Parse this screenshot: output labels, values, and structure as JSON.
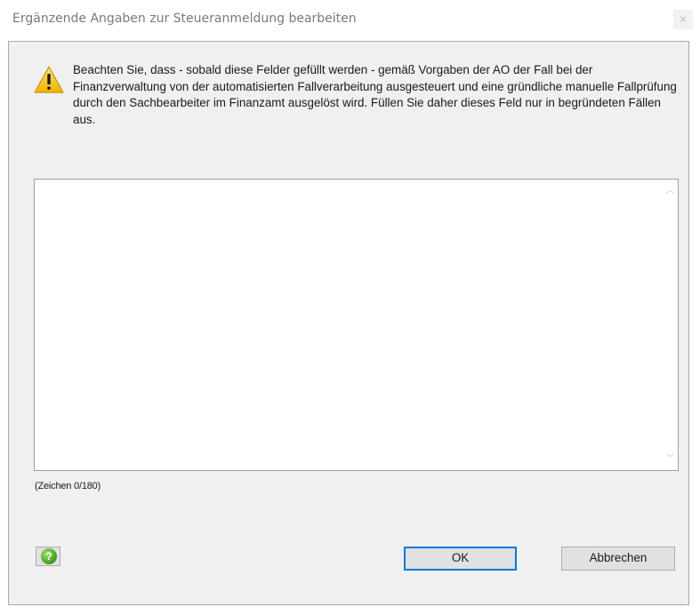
{
  "window": {
    "title": "Ergänzende Angaben zur Steueranmeldung bearbeiten",
    "close_glyph": "✕"
  },
  "warning": {
    "icon": "warning-triangle-icon",
    "text": "Beachten Sie, dass - sobald diese Felder gefüllt werden - gemäß Vorgaben der AO der Fall bei der Finanzverwaltung von der automatisierten Fallverarbeitung ausgesteuert und eine gründliche manuelle Fallprüfung durch den Sachbearbeiter im Finanzamt ausgelöst wird. Füllen Sie daher dieses Feld nur in begründeten Fällen aus."
  },
  "textbox": {
    "value": "",
    "scroll_up_glyph": "︿",
    "scroll_down_glyph": "﹀"
  },
  "counter": {
    "text": "(Zeichen 0/180)"
  },
  "buttons": {
    "help_glyph": "?",
    "ok_label": "OK",
    "cancel_label": "Abbrechen"
  },
  "colors": {
    "accent": "#0078d7",
    "dialog_bg": "#f0f0f0",
    "warning_yellow": "#f7c318",
    "help_green": "#4caf25"
  }
}
